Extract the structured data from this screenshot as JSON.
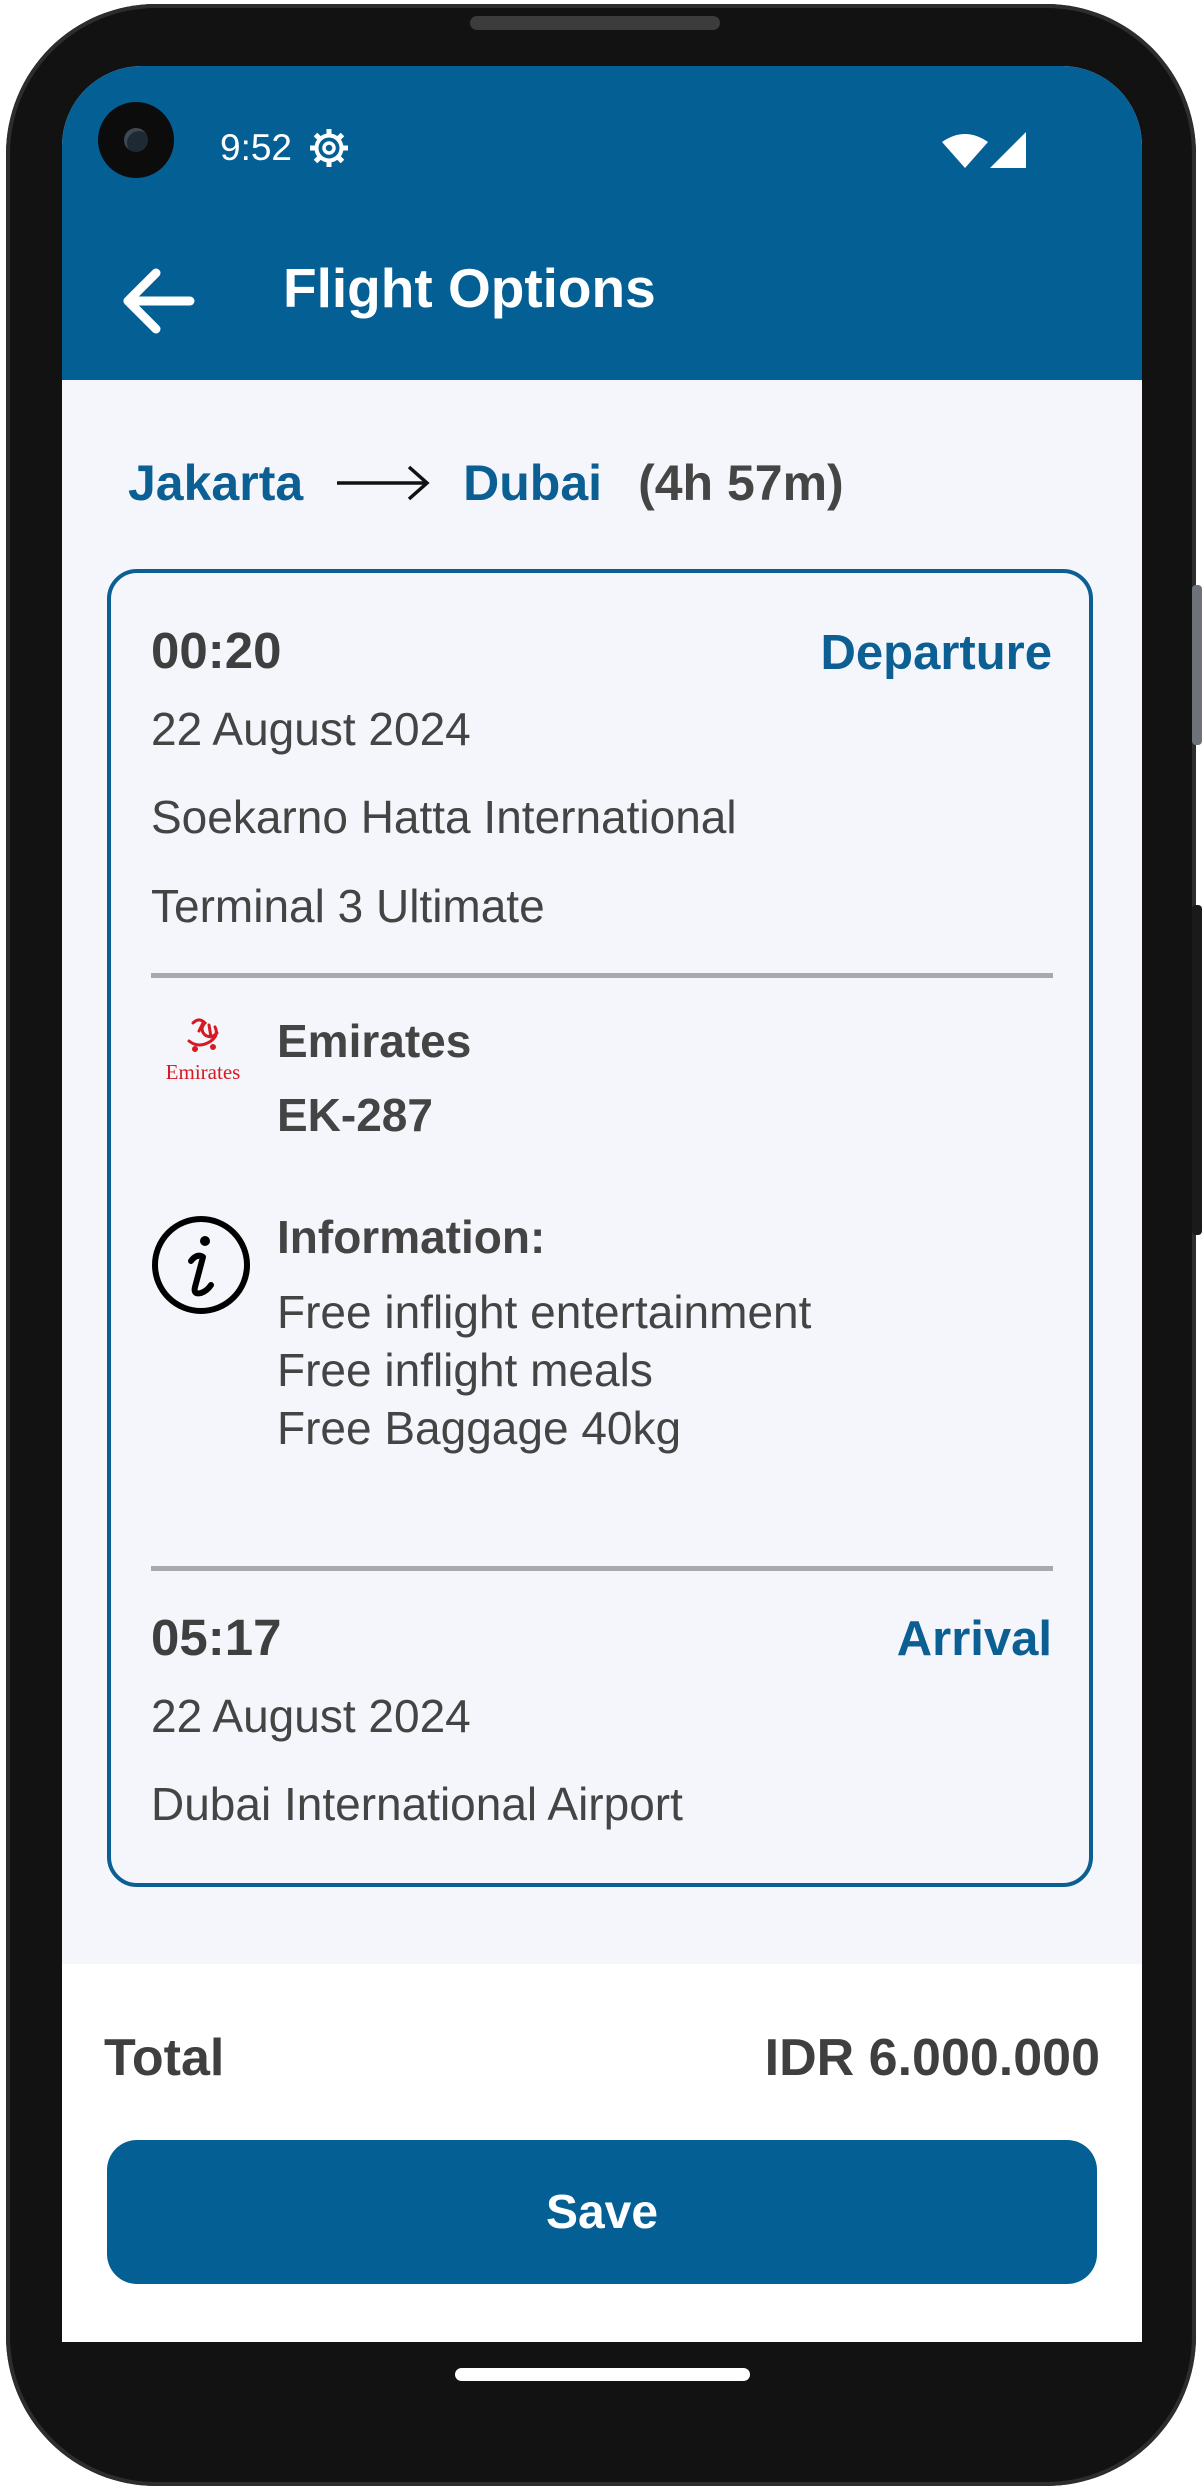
{
  "status_bar": {
    "time": "9:52",
    "icons": [
      "settings-gear-icon",
      "wifi-icon",
      "cellular-signal-icon"
    ]
  },
  "header": {
    "title": "Flight Options",
    "back_icon": "arrow-left-icon"
  },
  "route": {
    "origin": "Jakarta",
    "destination": "Dubai",
    "duration": "(4h 57m)"
  },
  "departure": {
    "time": "00:20",
    "label": "Departure",
    "date": "22 August 2024",
    "airport": "Soekarno Hatta International",
    "terminal": "Terminal 3 Ultimate"
  },
  "airline": {
    "name": "Emirates",
    "flight_number": "EK-287",
    "logo_text": "Emirates"
  },
  "information": {
    "title": "Information:",
    "items": [
      "Free inflight entertainment",
      "Free inflight meals",
      "Free Baggage 40kg"
    ]
  },
  "arrival": {
    "time": "05:17",
    "label": "Arrival",
    "date": "22 August 2024",
    "airport": "Dubai International Airport"
  },
  "footer": {
    "total_label": "Total",
    "total_value": "IDR 6.000.000",
    "save_label": "Save"
  },
  "colors": {
    "primary": "#045f95",
    "accent_text": "#0b5f92",
    "background": "#f4f6fb",
    "text": "#444444",
    "divider": "#a8a9ad",
    "emirates_red": "#d71921"
  }
}
